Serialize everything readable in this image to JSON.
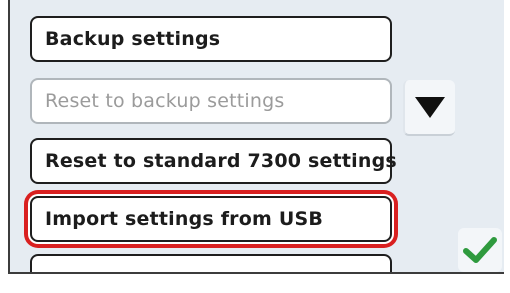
{
  "menu": {
    "items": [
      {
        "label": "Backup settings",
        "state": "enabled"
      },
      {
        "label": "Reset to backup settings",
        "state": "disabled"
      },
      {
        "label": "Reset to standard 7300 settings",
        "state": "enabled"
      },
      {
        "label": "Import settings from USB",
        "state": "highlighted"
      }
    ]
  },
  "icons": {
    "scroll": "scroll-down-triangle-icon",
    "confirm": "checkmark-icon"
  },
  "colors": {
    "panel_background": "#e6ecf2",
    "highlight_outline": "#d92020",
    "checkmark": "#2e9a3e"
  }
}
